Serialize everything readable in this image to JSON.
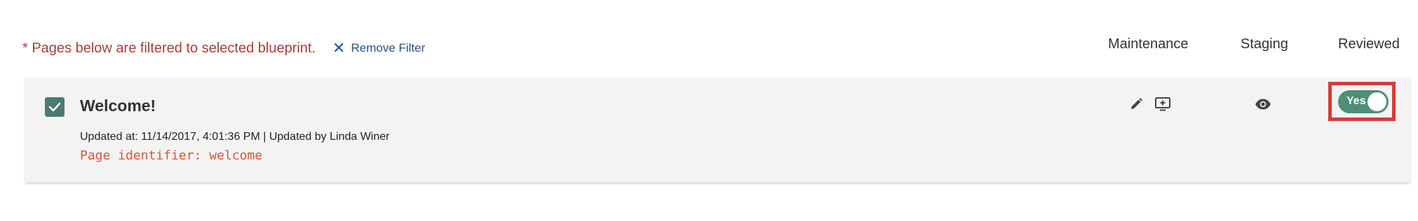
{
  "filter": {
    "note": "* Pages below are filtered to selected blueprint.",
    "remove_label": "Remove Filter"
  },
  "columns": {
    "maintenance": "Maintenance",
    "staging": "Staging",
    "reviewed": "Reviewed"
  },
  "row": {
    "checked": true,
    "title": "Welcome!",
    "updated": "Updated at: 11/14/2017, 4:01:36 PM | Updated by Linda Winer",
    "identifier": "Page identifier: welcome",
    "reviewed_label": "Yes",
    "reviewed": true
  },
  "icons": {
    "remove": "close-icon",
    "checkbox": "check-icon",
    "edit": "pencil-icon",
    "preview": "preview-plus-icon",
    "view": "eye-icon"
  },
  "colors": {
    "filter_note": "#a2413a",
    "link": "#2b4f8a",
    "checkbox": "#4d7a73",
    "identifier": "#d4573b",
    "toggle_on": "#4e8f78",
    "highlight": "#d63b36",
    "row_bg": "#f3f3f3"
  }
}
